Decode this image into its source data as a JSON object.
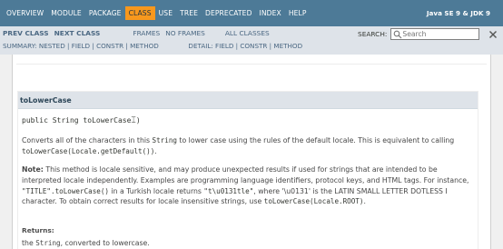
{
  "topnav": {
    "items": [
      "OVERVIEW",
      "MODULE",
      "PACKAGE",
      "CLASS",
      "USE",
      "TREE",
      "DEPRECATED",
      "INDEX",
      "HELP"
    ],
    "active": "CLASS",
    "about": "Java SE 9 & JDK 9",
    "bg_color": "#4d7a97",
    "active_color": "#f8981d"
  },
  "subnav": {
    "prev_class": "PREV CLASS",
    "next_class": "NEXT CLASS",
    "frames": "FRAMES",
    "no_frames": "NO FRAMES",
    "all_classes": "ALL CLASSES",
    "summary": "SUMMARY: NESTED | FIELD | CONSTR | METHOD",
    "detail": "DETAIL: FIELD | CONSTR | METHOD",
    "search_label": "SEARCH:",
    "search_placeholder": "Search",
    "search_icon": "search-icon",
    "reset_icon": "reset-icon"
  },
  "member": {
    "name": "toLowerCase",
    "signature": "public String toLowerCase",
    "signature_tail": ")",
    "desc_part1": "Converts all of the characters in this ",
    "desc_code1": "String",
    "desc_part2": " to lower case using the rules of the default locale. This is equivalent to calling ",
    "desc_code2": "toLowerCase(Locale.getDefault())",
    "desc_part3": ".",
    "note_label": "Note:",
    "note_part1": " This method is locale sensitive, and may produce unexpected results if used for strings that are intended to be interpreted locale independently. Examples are programming language identifiers, protocol keys, and HTML tags. For instance, ",
    "note_code1": "\"TITLE\".toLowerCase()",
    "note_part2": " in a Turkish locale returns ",
    "note_code2": "\"t\\u0131tle\"",
    "note_part3": ", where '\\u0131' is the LATIN SMALL LETTER DOTLESS I character. To obtain correct results for locale insensitive strings, use ",
    "note_code3": "toLowerCase(Locale.ROOT)",
    "note_part4": ".",
    "returns_label": "Returns:",
    "returns_part1": "the ",
    "returns_code": "String",
    "returns_part2": ", converted to lowercase."
  }
}
